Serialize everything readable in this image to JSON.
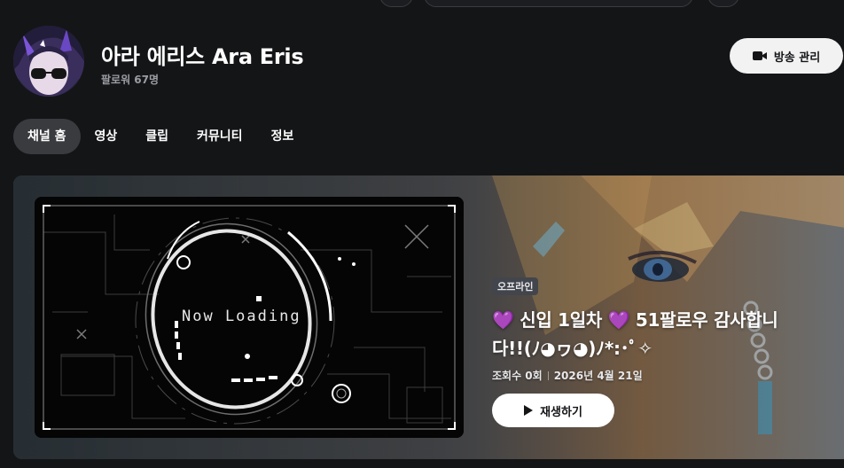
{
  "channel": {
    "name": "아라 에리스 Ara Eris",
    "followers": "팔로워 67명",
    "manage_label": "방송 관리"
  },
  "tabs": [
    {
      "label": "채널 홈",
      "active": true
    },
    {
      "label": "영상",
      "active": false
    },
    {
      "label": "클립",
      "active": false
    },
    {
      "label": "커뮤니티",
      "active": false
    },
    {
      "label": "정보",
      "active": false
    }
  ],
  "hero": {
    "thumbnail_text": "Now Loading",
    "badge": "오프라인",
    "title_line1": "💜 신입 1일차 💜 51팔로우 감사합니",
    "title_line2": "다!!(ﾉ◕ヮ◕)ﾉ*:･ﾟ✧",
    "views": "조회수 0회",
    "date": "2026년 4월 21일",
    "play_label": "재생하기"
  },
  "icons": {
    "manage": "video-camera-icon",
    "play": "play-icon"
  },
  "colors": {
    "background": "#141517",
    "accent_button": "#f2f2f3",
    "tab_active": "#3a3b3f",
    "badge": "#42454c",
    "heart": "#a66bff"
  }
}
